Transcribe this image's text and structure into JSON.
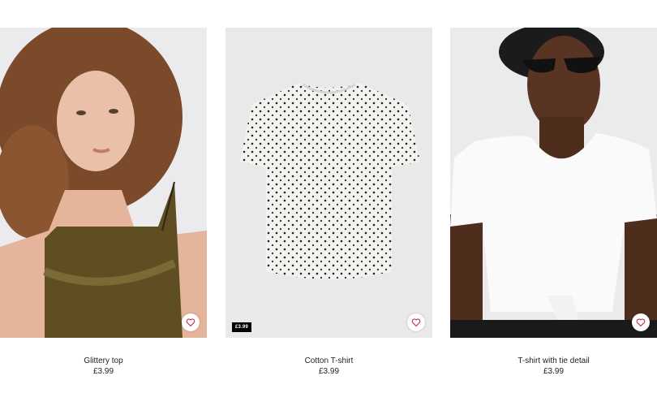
{
  "products": [
    {
      "name": "Glittery top",
      "price": "£3.99",
      "badge": ""
    },
    {
      "name": "Cotton T-shirt",
      "price": "£3.99",
      "badge": "£3.99"
    },
    {
      "name": "T-shirt with tie detail",
      "price": "£3.99",
      "badge": ""
    }
  ],
  "icons": {
    "wishlist": "heart-outline-icon"
  },
  "colors": {
    "wishlist_heart": "#c0203a",
    "badge_bg": "#000000",
    "badge_text": "#ffffff"
  }
}
